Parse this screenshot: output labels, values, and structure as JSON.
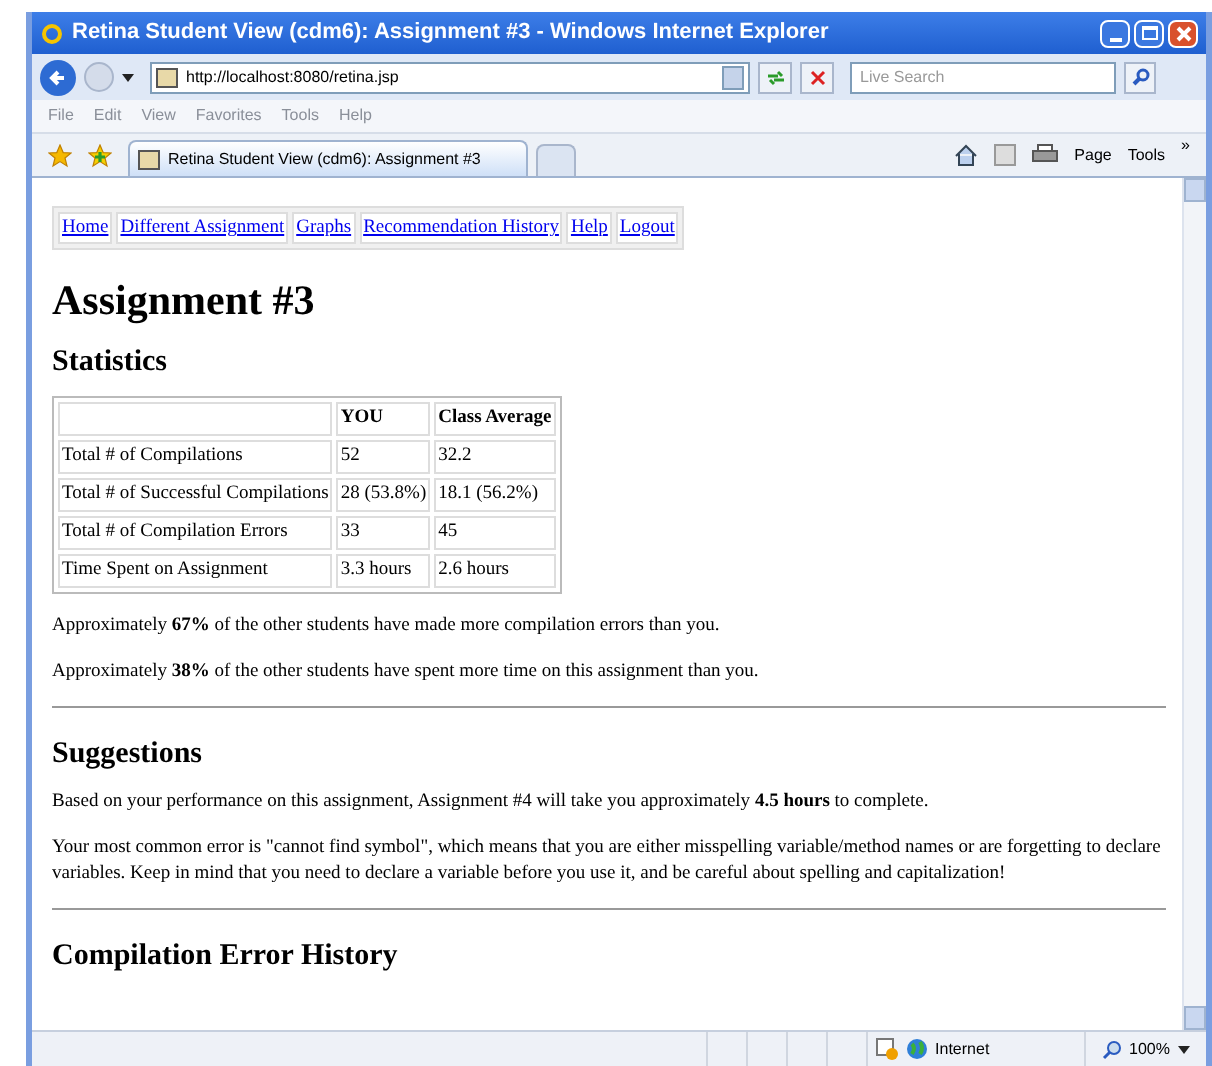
{
  "window": {
    "title": "Retina Student View (cdm6): Assignment #3 - Windows Internet Explorer"
  },
  "address_bar": {
    "url": "http://localhost:8080/retina.jsp"
  },
  "search": {
    "placeholder": "Live Search"
  },
  "menu": [
    "File",
    "Edit",
    "View",
    "Favorites",
    "Tools",
    "Help"
  ],
  "tab": {
    "title": "Retina Student View (cdm6): Assignment #3"
  },
  "command_bar": [
    "Page",
    "Tools"
  ],
  "overflow_chevron": "»",
  "page": {
    "nav_links": [
      "Home",
      "Different Assignment",
      "Graphs",
      "Recommendation History",
      "Help",
      "Logout"
    ],
    "heading": "Assignment #3",
    "statistics": {
      "title": "Statistics",
      "table": {
        "columns": [
          "",
          "YOU",
          "Class Average"
        ],
        "rows": [
          [
            "Total # of Compilations",
            "52",
            "32.2"
          ],
          [
            "Total # of Successful Compilations",
            "28 (53.8%)",
            "18.1 (56.2%)"
          ],
          [
            "Total # of Compilation Errors",
            "33",
            "45"
          ],
          [
            "Time Spent on Assignment",
            "3.3 hours",
            "2.6 hours"
          ]
        ]
      },
      "notes": [
        "Approximately **67%** of the other students have made more compilation errors than you.",
        "Approximately **38%** of the other students have spent more time on this assignment than you."
      ]
    },
    "suggestions": {
      "title": "Suggestions",
      "paragraphs": [
        "Based on your performance on this assignment, Assignment #4 will take you approximately **4.5 hours** to complete.",
        "Your most common error is \"cannot find symbol\", which means that you are either misspelling variable/method names or are forgetting to declare variables. Keep in mind that you need to declare a variable before you use it, and be careful about spelling and capitalization!"
      ]
    },
    "history": {
      "title": "Compilation Error History"
    }
  },
  "status_bar": {
    "zone": "Internet",
    "zoom": "100%"
  }
}
